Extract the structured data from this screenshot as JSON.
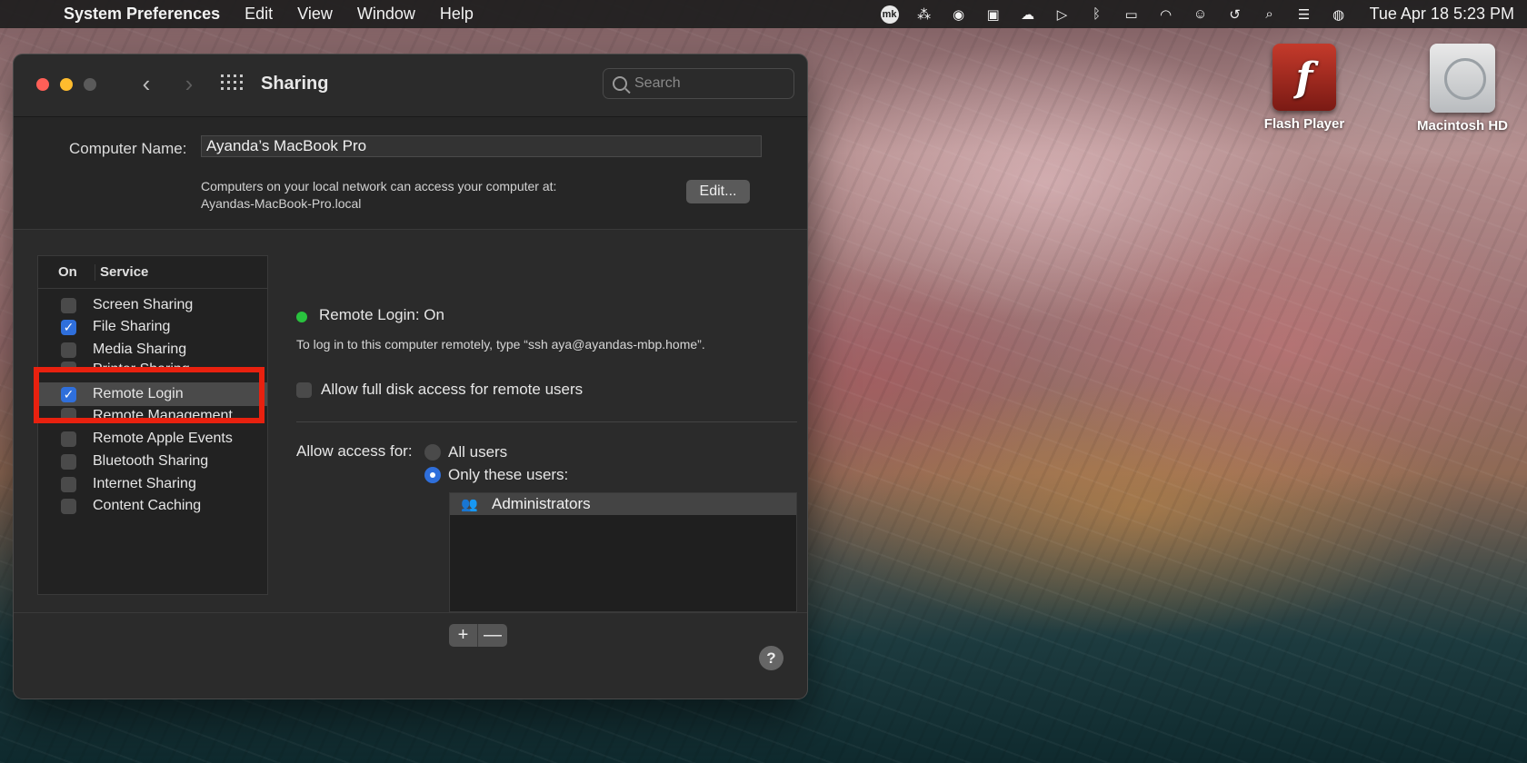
{
  "menubar": {
    "app_name": "System Preferences",
    "items": [
      "Edit",
      "View",
      "Window",
      "Help"
    ],
    "clock": "Tue Apr 18  5:23 PM",
    "tray_icons": [
      "mk-icon",
      "dots-icon",
      "grammarly-icon",
      "copy-icon",
      "creative-cloud-icon",
      "play-icon",
      "bluetooth-icon",
      "battery-icon",
      "wifi-icon",
      "user-icon",
      "time-machine-icon",
      "spotlight-icon",
      "control-center-icon",
      "siri-icon"
    ],
    "mk_label": "mk"
  },
  "desktop": {
    "flash_label": "Flash Player",
    "hd_label": "Macintosh HD"
  },
  "window": {
    "title": "Sharing",
    "search_placeholder": "Search",
    "computer_name_label": "Computer Name:",
    "computer_name_value": "Ayanda’s MacBook Pro",
    "network_line1": "Computers on your local network can access your computer at:",
    "network_line2": "Ayandas-MacBook-Pro.local",
    "edit_button": "Edit...",
    "services_header_on": "On",
    "services_header_service": "Service",
    "services": [
      {
        "label": "Screen Sharing",
        "checked": false
      },
      {
        "label": "File Sharing",
        "checked": true
      },
      {
        "label": "Media Sharing",
        "checked": false
      },
      {
        "label": "Printer Sharing",
        "checked": false
      },
      {
        "label": "Remote Login",
        "checked": true
      },
      {
        "label": "Remote Management",
        "checked": false
      },
      {
        "label": "Remote Apple Events",
        "checked": false
      },
      {
        "label": "Bluetooth Sharing",
        "checked": false
      },
      {
        "label": "Internet Sharing",
        "checked": false
      },
      {
        "label": "Content Caching",
        "checked": false
      }
    ],
    "status_title": "Remote Login: On",
    "status_desc": "To log in to this computer remotely, type “ssh aya@ayandas-mbp.home”.",
    "full_disk_label": "Allow full disk access for remote users",
    "allow_access_label": "Allow access for:",
    "radio_all": "All users",
    "radio_only": "Only these users:",
    "users": [
      "Administrators"
    ],
    "plus": "+",
    "minus": "—",
    "help": "?"
  },
  "colors": {
    "accent": "#2f6fdb",
    "status_on": "#29c23e",
    "highlight": "#e8210f"
  }
}
